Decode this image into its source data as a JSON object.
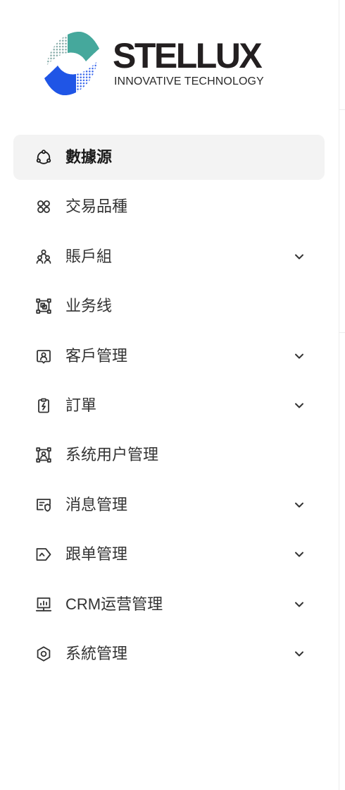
{
  "brand": {
    "name": "STELLUX",
    "tagline": "INNOVATIVE TECHNOLOGY",
    "logo_icon": "stellux-logo-mark"
  },
  "colors": {
    "brand_teal": "#45a89c",
    "brand_teal_dots": "#86aba8",
    "brand_blue": "#1f55e6",
    "brand_blue_dots": "#3a67ec",
    "logo_text": "#231f20",
    "active_background": "#f3f3f3",
    "text": "#333333",
    "active_text": "#1a1a1a",
    "divider": "#ececec"
  },
  "menu": {
    "expand_icon": "chevron-down-icon",
    "items": [
      {
        "label": "數據源",
        "icon": "data-source-icon",
        "active": true,
        "expandable": false
      },
      {
        "label": "交易品種",
        "icon": "trading-instruments-icon",
        "active": false,
        "expandable": false
      },
      {
        "label": "賬戶組",
        "icon": "account-group-icon",
        "active": false,
        "expandable": true
      },
      {
        "label": "业务线",
        "icon": "business-line-icon",
        "active": false,
        "expandable": false
      },
      {
        "label": "客戶管理",
        "icon": "customer-management-icon",
        "active": false,
        "expandable": true
      },
      {
        "label": "訂單",
        "icon": "order-icon",
        "active": false,
        "expandable": true
      },
      {
        "label": "系统用户管理",
        "icon": "system-user-icon",
        "active": false,
        "expandable": false
      },
      {
        "label": "消息管理",
        "icon": "message-management-icon",
        "active": false,
        "expandable": true
      },
      {
        "label": "跟单管理",
        "icon": "copy-trading-icon",
        "active": false,
        "expandable": true
      },
      {
        "label": "CRM运营管理",
        "icon": "crm-operations-icon",
        "active": false,
        "expandable": true
      },
      {
        "label": "系統管理",
        "icon": "settings-gear-icon",
        "active": false,
        "expandable": true
      }
    ]
  }
}
